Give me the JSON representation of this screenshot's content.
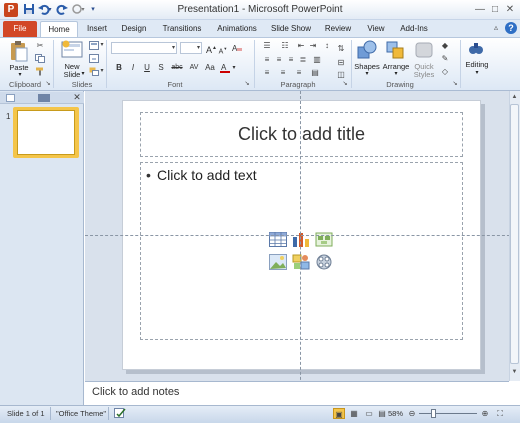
{
  "window": {
    "app_icon_label": "P",
    "title": "Presentation1 - Microsoft PowerPoint",
    "quick_access": {
      "save": "save-icon",
      "undo": "undo-icon",
      "redo": "redo-icon",
      "repeat": "repeat-icon",
      "customize": "customize-icon"
    },
    "controls": {
      "minimize": "—",
      "maximize": "□",
      "close": "✕"
    }
  },
  "tabs": {
    "file": "File",
    "home": "Home",
    "insert": "Insert",
    "design": "Design",
    "transitions": "Transitions",
    "animations": "Animations",
    "slide_show": "Slide Show",
    "review": "Review",
    "view": "View",
    "add_ins": "Add-Ins",
    "help": "?"
  },
  "ribbon": {
    "clipboard": {
      "label": "Clipboard",
      "paste": "Paste"
    },
    "slides": {
      "label": "Slides",
      "new_slide_line1": "New",
      "new_slide_line2": "Slide"
    },
    "font": {
      "label": "Font",
      "bold": "B",
      "italic": "I",
      "underline": "U",
      "strike": "S",
      "abc": "abc"
    },
    "paragraph": {
      "label": "Paragraph"
    },
    "drawing": {
      "label": "Drawing",
      "shapes": "Shapes",
      "arrange": "Arrange",
      "quick_styles_1": "Quick",
      "quick_styles_2": "Styles"
    },
    "editing": {
      "label": "Editing"
    }
  },
  "slide": {
    "title_placeholder": "Click to add title",
    "content_placeholder": "Click to add text",
    "bullet": "•",
    "thumbnail_number": "1"
  },
  "notes": {
    "placeholder": "Click to add notes"
  },
  "status": {
    "slide_info": "Slide 1 of 1",
    "theme": "\"Office Theme\"",
    "zoom_percent": "58%",
    "zoom_level": 0.58
  },
  "colors": {
    "file_tab": "#d24726",
    "ribbon_bg": "#dde8f5",
    "thumbnail_selected": "#f4c54a"
  }
}
